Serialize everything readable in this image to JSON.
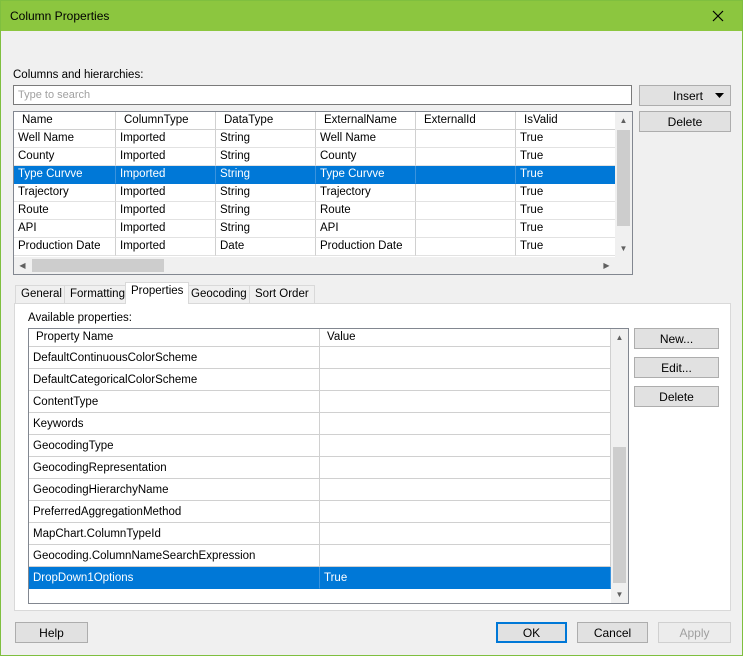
{
  "window": {
    "title": "Column Properties"
  },
  "columns_label": "Columns and hierarchies:",
  "search": {
    "placeholder": "Type to search",
    "value": ""
  },
  "buttons": {
    "insert": "Insert",
    "delete_top": "Delete",
    "new": "New...",
    "edit": "Edit...",
    "delete_props": "Delete",
    "help": "Help",
    "ok": "OK",
    "cancel": "Cancel",
    "apply": "Apply"
  },
  "columns_grid": {
    "headers": [
      "Name",
      "ColumnType",
      "DataType",
      "ExternalName",
      "ExternalId",
      "IsValid"
    ],
    "rows": [
      [
        "Well Name",
        "Imported",
        "String",
        "Well Name",
        "",
        "True"
      ],
      [
        "County",
        "Imported",
        "String",
        "County",
        "",
        "True"
      ],
      [
        "Type Curvve",
        "Imported",
        "String",
        "Type Curvve",
        "",
        "True"
      ],
      [
        "Trajectory",
        "Imported",
        "String",
        "Trajectory",
        "",
        "True"
      ],
      [
        "Route",
        "Imported",
        "String",
        "Route",
        "",
        "True"
      ],
      [
        "API",
        "Imported",
        "String",
        "API",
        "",
        "True"
      ],
      [
        "Production Date",
        "Imported",
        "Date",
        "Production Date",
        "",
        "True"
      ]
    ],
    "selected_row": 2
  },
  "tabs": [
    "General",
    "Formatting",
    "Properties",
    "Geocoding",
    "Sort Order"
  ],
  "active_tab": "Properties",
  "available_label": "Available properties:",
  "properties_grid": {
    "headers": [
      "Property Name",
      "Value"
    ],
    "rows": [
      [
        "DefaultContinuousColorScheme",
        ""
      ],
      [
        "DefaultCategoricalColorScheme",
        ""
      ],
      [
        "ContentType",
        ""
      ],
      [
        "Keywords",
        ""
      ],
      [
        "GeocodingType",
        ""
      ],
      [
        "GeocodingRepresentation",
        ""
      ],
      [
        "GeocodingHierarchyName",
        ""
      ],
      [
        "PreferredAggregationMethod",
        ""
      ],
      [
        "MapChart.ColumnTypeId",
        ""
      ],
      [
        "Geocoding.ColumnNameSearchExpression",
        ""
      ],
      [
        "DropDown1Options",
        "True"
      ]
    ],
    "selected_row": 10
  },
  "colors": {
    "titlebar": "#8cc63f",
    "selection": "#0078d7"
  }
}
